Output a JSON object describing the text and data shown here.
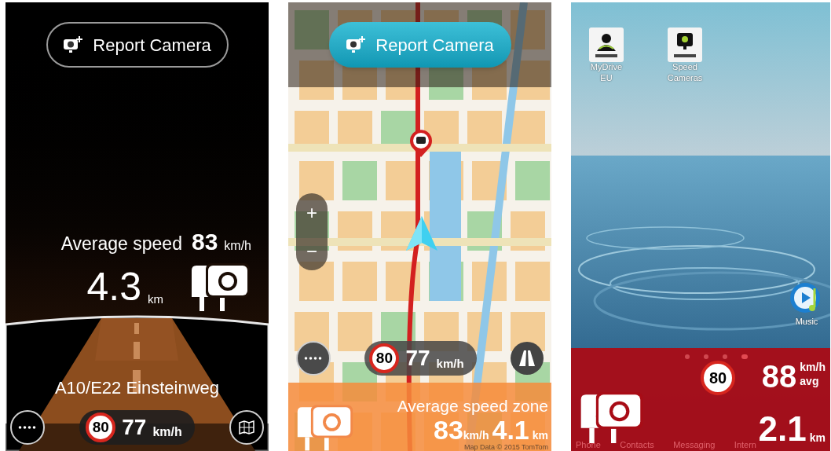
{
  "dashboard_screen": {
    "report_button": "Report Camera",
    "average_speed_label": "Average speed",
    "average_speed": "83",
    "average_speed_unit": "km/h",
    "distance": "4.3",
    "distance_unit": "km",
    "street": "A10/E22 Einsteinweg",
    "speed_limit": "80",
    "current_speed": "77",
    "current_speed_unit": "km/h"
  },
  "map_screen": {
    "report_button": "Report Camera",
    "zoom_in": "+",
    "zoom_out": "−",
    "speed_limit": "80",
    "current_speed": "77",
    "current_speed_unit": "km/h",
    "zone_label": "Average speed zone",
    "average_speed": "83",
    "average_speed_unit": "km/h",
    "distance": "4.1",
    "distance_unit": "km",
    "attribution": "Map Data © 2015 TomTom"
  },
  "home_screen": {
    "apps": [
      {
        "label": "MyDrive EU"
      },
      {
        "label": "Speed Cameras"
      }
    ],
    "music_app": "Music",
    "page_dots": [
      {
        "selected": false
      },
      {
        "selected": false
      },
      {
        "selected": false
      },
      {
        "selected": true
      }
    ],
    "dock": [
      "Phone",
      "Contacts",
      "Messaging",
      "Intern"
    ],
    "speed_limit": "80",
    "average_speed": "88",
    "average_speed_unit": "km/h",
    "average_label": "avg",
    "distance": "2.1",
    "distance_unit": "km"
  }
}
